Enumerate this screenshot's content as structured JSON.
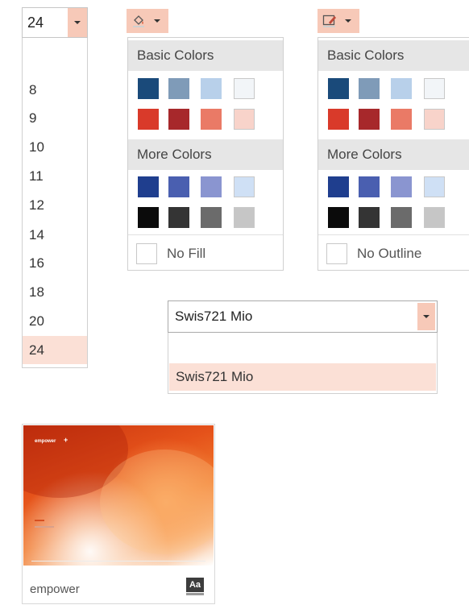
{
  "font_size": {
    "current": "24",
    "options": [
      "8",
      "9",
      "10",
      "11",
      "12",
      "14",
      "16",
      "18",
      "20",
      "24"
    ],
    "selected": "24"
  },
  "fill_palette": {
    "icon": "paint-bucket-icon",
    "basic_label": "Basic Colors",
    "more_label": "More Colors",
    "none_label": "No Fill"
  },
  "outline_palette": {
    "icon": "pen-outline-icon",
    "basic_label": "Basic Colors",
    "more_label": "More Colors",
    "none_label": "No Outline"
  },
  "colors": {
    "basic": [
      "#1a4a7a",
      "#7f9bb8",
      "#b8d0ea",
      "#f2f5f8",
      "#d93a2a",
      "#a7282b",
      "#ea7a66",
      "#f8d3ca"
    ],
    "more": [
      "#1f3e8e",
      "#4a5fb0",
      "#8a95d0",
      "#cfe0f5",
      "#0b0b0b",
      "#343434",
      "#6b6b6b",
      "#c6c6c6"
    ],
    "accent": "#f7c9b8",
    "selected_row": "#fbe0d6"
  },
  "font_name": {
    "current": "Swis721 Mio",
    "options": [
      "Swis721 Mio"
    ]
  },
  "theme": {
    "name": "empower",
    "brand_logo": "empower",
    "badge": "Aa"
  }
}
